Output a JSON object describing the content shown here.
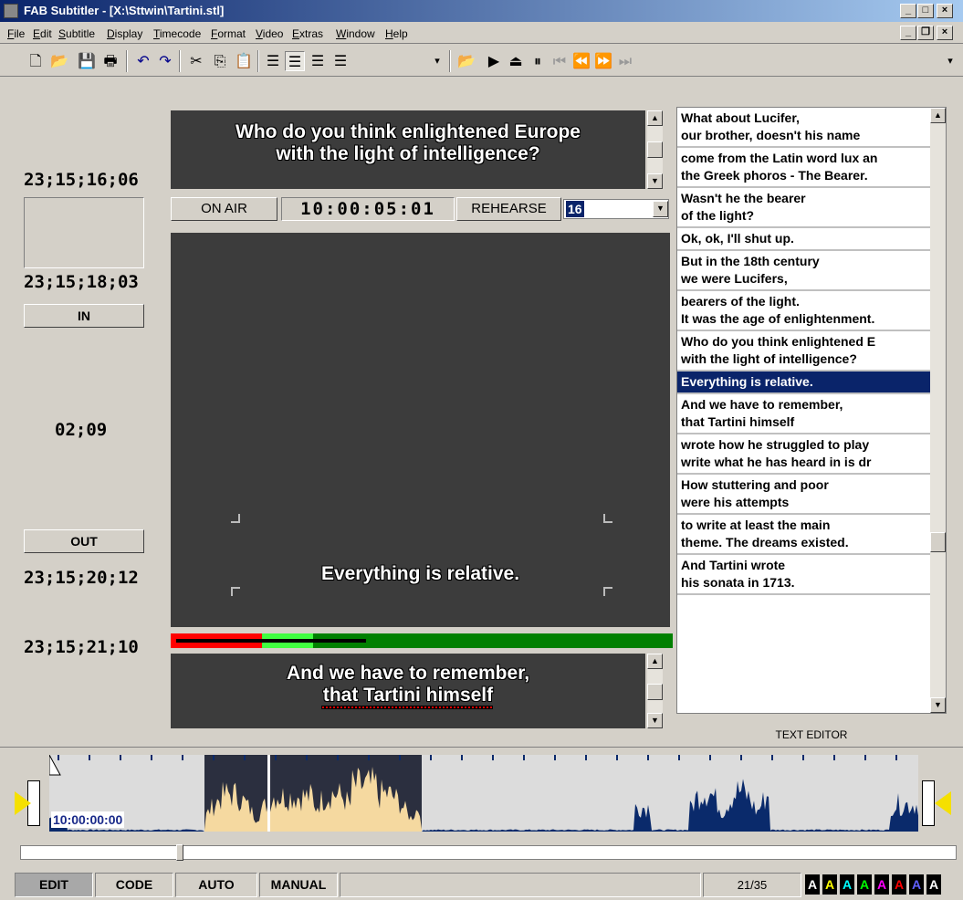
{
  "window": {
    "title": "FAB Subtitler - [X:\\Sttwin\\Tartini.stl]"
  },
  "menu": [
    "File",
    "Edit",
    "Subtitle",
    "Display",
    "Timecode",
    "Format",
    "Video",
    "Extras",
    "Window",
    "Help"
  ],
  "toolbar": {
    "icons": [
      "new-icon",
      "open-icon",
      "save-icon",
      "print-icon",
      "undo-icon",
      "redo-icon",
      "cut-icon",
      "copy-icon",
      "paste-icon",
      "align-left-icon",
      "align-center-icon",
      "align-right-icon",
      "justify-icon",
      "video-open-icon",
      "play-icon",
      "eject-icon",
      "pause-icon",
      "skip-start-icon",
      "rewind-icon",
      "fast-forward-icon",
      "skip-end-icon"
    ]
  },
  "left_panel": {
    "tc_top": "23;15;16;06",
    "tc_in_time": "23;15;18;03",
    "in_label": "IN",
    "duration": "02;09",
    "out_label": "OUT",
    "tc_out_time": "23;15;20;12",
    "tc_bottom": "23;15;21;10"
  },
  "prev_subtitle": {
    "line1": "Who do you think enlightened Europe",
    "line2": "with the light of intelligence?"
  },
  "control_bar": {
    "on_air": "ON AIR",
    "timecode": "10:00:05:01",
    "rehearse": "REHEARSE",
    "number": "16"
  },
  "video_subtitle": "Everything is relative.",
  "next_subtitle": {
    "line1": "And we have to remember,",
    "line2": "that Tartini himself"
  },
  "subtitle_list": [
    {
      "l1": "What about Lucifer,",
      "l2": "our brother, doesn't his name"
    },
    {
      "l1": "come from the Latin word lux an",
      "l2": "the Greek phoros - The Bearer."
    },
    {
      "l1": "Wasn't he the bearer",
      "l2": "of the light?"
    },
    {
      "l1": "Ok, ok, I'll shut up.",
      "l2": ""
    },
    {
      "l1": "But in the 18th century",
      "l2": "we were Lucifers,"
    },
    {
      "l1": "bearers of the light.",
      "l2": "It was the age of enlightenment."
    },
    {
      "l1": "Who do you think enlightened E",
      "l2": "with the light of intelligence?"
    },
    {
      "l1": "Everything is relative.",
      "l2": "",
      "selected": true
    },
    {
      "l1": "And we have to remember,",
      "l2": "that Tartini himself"
    },
    {
      "l1": "wrote how he struggled to play",
      "l2": "write what he has heard in is dr"
    },
    {
      "l1": "How stuttering and poor",
      "l2": "were his attempts"
    },
    {
      "l1": "to write at least the main",
      "l2": "theme. The dreams existed."
    },
    {
      "l1": "And Tartini wrote",
      "l2": "his sonata in 1713."
    }
  ],
  "text_editor_label": "TEXT EDITOR",
  "waveform": {
    "timecode": "10:00:00:00"
  },
  "status_bar": {
    "edit": "EDIT",
    "code": "CODE",
    "auto": "AUTO",
    "manual": "MANUAL",
    "counter": "21/35",
    "font_swatch": "A"
  },
  "colors": {
    "selection": "#0a246a",
    "video_bg": "#3c3c3c",
    "progress_red": "#ff0000",
    "progress_green": "#008000",
    "waveform": "#0a2a6b",
    "waveform_highlight": "#f5d9a0"
  },
  "font_swatch_colors": [
    "#ffffff",
    "#ffff00",
    "#00ffff",
    "#00ff00",
    "#ff00ff",
    "#ff0000",
    "#6060ff",
    "#ffffff"
  ]
}
